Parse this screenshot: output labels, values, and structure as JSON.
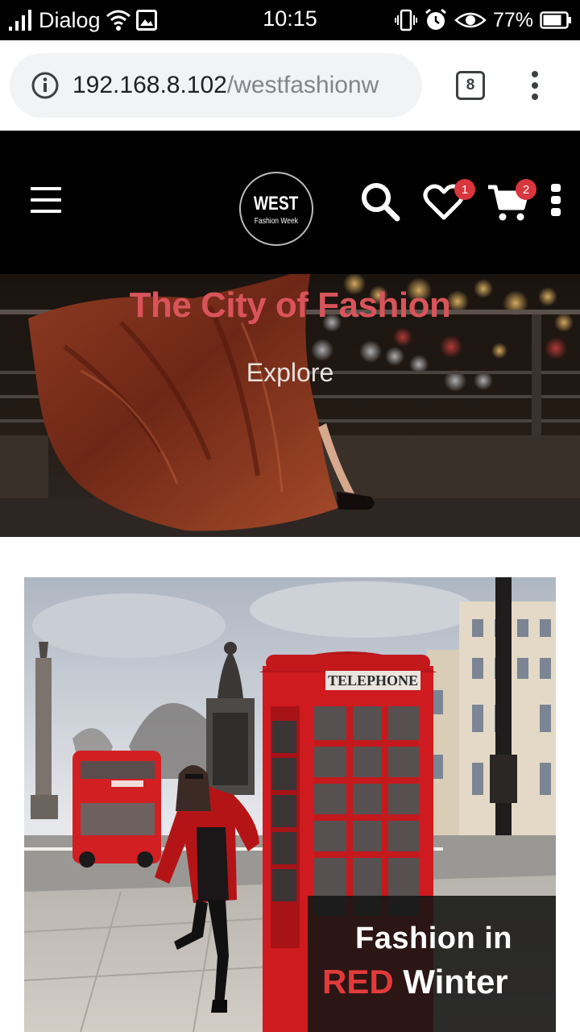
{
  "status_bar": {
    "carrier": "Dialog",
    "time": "10:15",
    "battery": "77%"
  },
  "browser": {
    "url_host": "192.168.8.102",
    "url_path": "/westfashionw",
    "tab_count": "8"
  },
  "site_header": {
    "logo_main": "WEST",
    "logo_sub": "Fashion Week",
    "wishlist_count": "1",
    "cart_count": "2"
  },
  "hero": {
    "title": "The City of Fashion",
    "cta": "Explore"
  },
  "feature_card": {
    "caption_line1": "Fashion in",
    "caption_highlight": "RED",
    "caption_rest": " Winter",
    "booth_sign": "TELEPHONE"
  },
  "colors": {
    "brand_red": "#d9545a",
    "badge_red": "#d9363e",
    "highlight_red": "#e23a3a"
  }
}
